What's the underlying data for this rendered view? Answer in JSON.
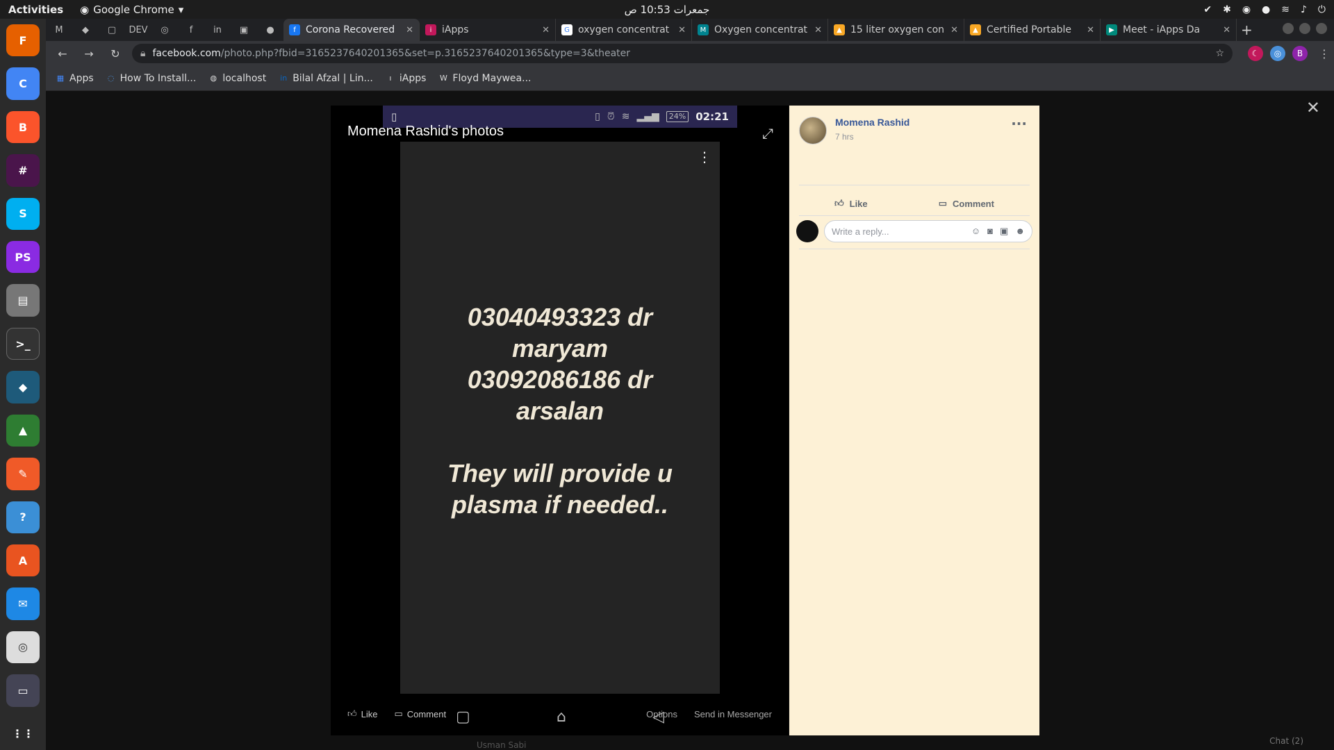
{
  "system": {
    "activities": "Activities",
    "app_name": "Google Chrome",
    "clock": "جمعرات 10:53 ص"
  },
  "browser": {
    "tabs": [
      {
        "title": "Corona Recovered",
        "active": true
      },
      {
        "title": "iApps"
      },
      {
        "title": "oxygen concentrat"
      },
      {
        "title": "Oxygen concentrat"
      },
      {
        "title": "15 liter oxygen con"
      },
      {
        "title": "Certified Portable"
      },
      {
        "title": "Meet - iApps Da"
      }
    ],
    "url_host": "facebook.com",
    "url_path": "/photo.php?fbid=3165237640201365&set=p.3165237640201365&type=3&theater",
    "profile_initial": "B",
    "bookmarks": [
      {
        "label": "Apps"
      },
      {
        "label": "How To Install..."
      },
      {
        "label": "localhost"
      },
      {
        "label": "Bilal Afzal | Lin..."
      },
      {
        "label": "iApps"
      },
      {
        "label": "Floyd Maywea..."
      }
    ]
  },
  "photo": {
    "title": "Momena Rashid's photos",
    "phone_time": "02:21",
    "battery": "24%",
    "message_lines": [
      "03040493323 dr",
      "maryam",
      "03092086186 dr",
      "arsalan",
      "",
      "They will provide u",
      "plasma if needed.."
    ],
    "actions": {
      "like": "Like",
      "comment": "Comment",
      "options": "Options",
      "send": "Send in Messenger"
    }
  },
  "post": {
    "author": "Momena Rashid",
    "time": "7 hrs",
    "like": "Like",
    "comment": "Comment",
    "reply_placeholder": "Write a reply..."
  },
  "footer": {
    "chat": "Chat (2)",
    "underlay_name": "Usman Sabi"
  }
}
